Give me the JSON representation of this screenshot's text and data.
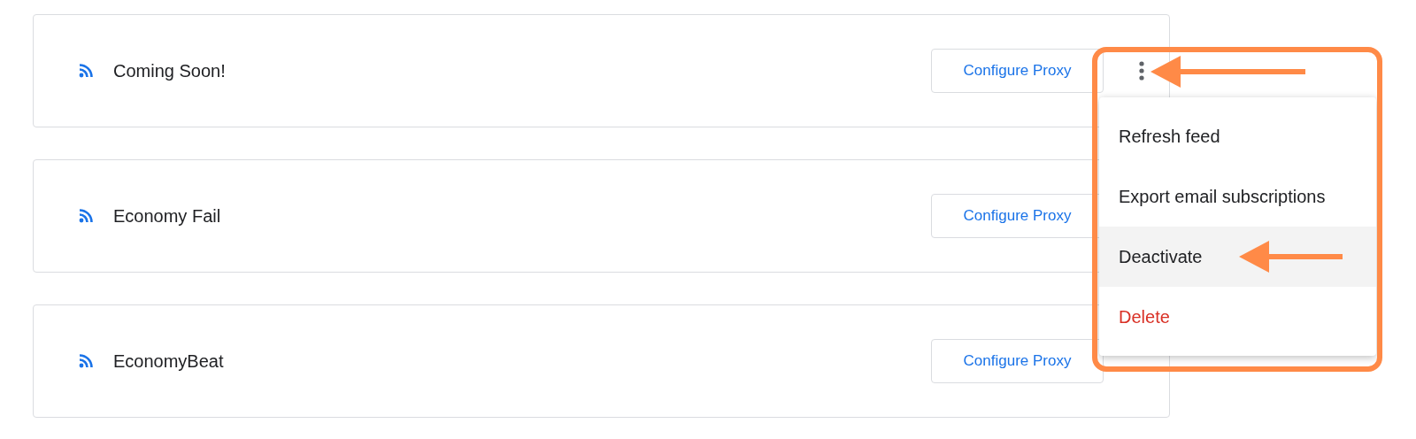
{
  "feeds": [
    {
      "name": "Coming Soon!",
      "button": "Configure Proxy",
      "menu_open": true
    },
    {
      "name": "Economy Fail",
      "button": "Configure Proxy",
      "menu_open": false
    },
    {
      "name": "EconomyBeat",
      "button": "Configure Proxy",
      "menu_open": false
    }
  ],
  "menu": {
    "items": [
      {
        "label": "Refresh feed",
        "kind": "normal",
        "highlighted": false
      },
      {
        "label": "Export email subscriptions",
        "kind": "normal",
        "highlighted": false
      },
      {
        "label": "Deactivate",
        "kind": "normal",
        "highlighted": true
      },
      {
        "label": "Delete",
        "kind": "danger",
        "highlighted": false
      }
    ]
  }
}
